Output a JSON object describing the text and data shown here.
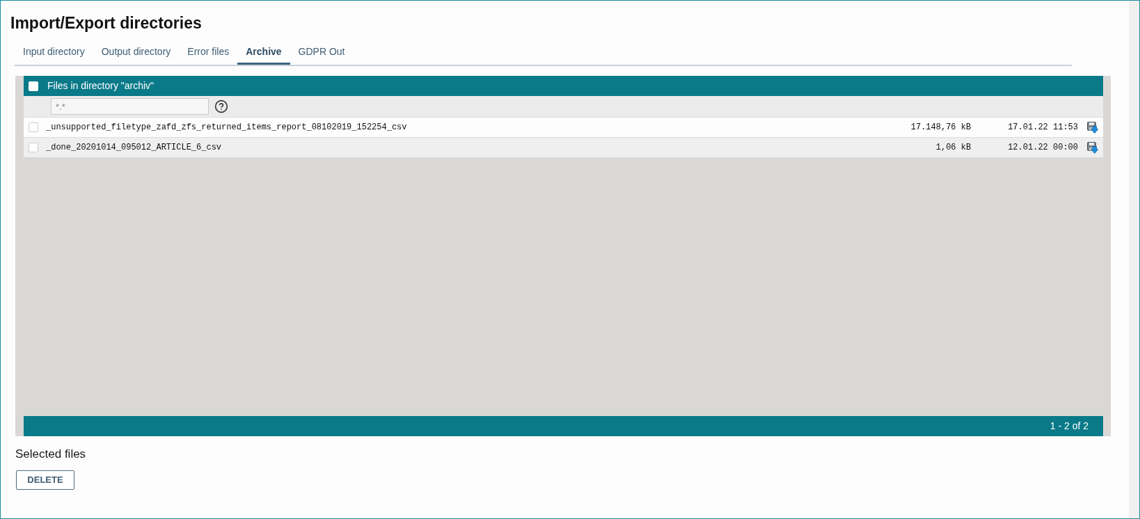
{
  "title": "Import/Export directories",
  "tabs": [
    {
      "label": "Input directory",
      "selected": false
    },
    {
      "label": "Output directory",
      "selected": false
    },
    {
      "label": "Error files",
      "selected": false
    },
    {
      "label": "Archive",
      "selected": true
    },
    {
      "label": "GDPR Out",
      "selected": false
    }
  ],
  "file_list": {
    "select_all": {
      "checked": false
    },
    "heading": "Files in directory \"archiv\"",
    "filter": {
      "placeholder": "*.*"
    },
    "rows": [
      {
        "checked": false,
        "name": "_unsupported_filetype_zafd_zfs_returned_items_report_08102019_152254_csv",
        "size": "17.148,76 kB",
        "date": "17.01.22 11:53"
      },
      {
        "checked": false,
        "name": "_done_20201014_095012_ARTICLE_6_csv",
        "size": "1,06 kB",
        "date": "12.01.22 00:00"
      }
    ],
    "pager": "1 - 2 of 2"
  },
  "selection": {
    "label": "Selected files",
    "buttons": [
      {
        "label": "DELETE"
      }
    ]
  }
}
